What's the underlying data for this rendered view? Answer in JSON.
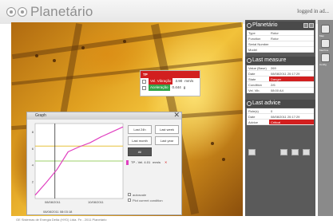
{
  "app": {
    "title": "Planetário",
    "logged_in": "logged in ad..."
  },
  "sensor_popup": {
    "header": "TP",
    "rows": [
      {
        "label": "Vel. Vibração",
        "value": "3.90",
        "unit": "mm/s",
        "color": "#d21f1f"
      },
      {
        "label": "Aceleração",
        "value": "0.444",
        "unit": "g",
        "color": "#33a54a"
      }
    ]
  },
  "graph": {
    "title": "Graph",
    "close": "✕",
    "buttons": [
      "Last 24h",
      "Last week",
      "Last month",
      "Last year",
      "All"
    ],
    "legend": {
      "label": "TP - Vel. 4.01",
      "unit": "mm/s",
      "remove": "✕",
      "color": "#e040c0"
    },
    "options": [
      "autoscale",
      "Plot current condition"
    ],
    "x_ticks": [
      "08/08/2011",
      "10/08/2011"
    ],
    "date_readout": "08/08/2011 08:03:18"
  },
  "chart_data": {
    "type": "line",
    "title": "",
    "xlabel": "",
    "ylabel": "",
    "x_ticks": [
      "08/08/2011",
      "10/08/2011"
    ],
    "y_ticks": [
      8,
      6,
      4,
      2
    ],
    "ylim": [
      0,
      9
    ],
    "thresholds": [
      {
        "value": 6.3,
        "color": "#e7c23a"
      },
      {
        "value": 4.5,
        "color": "#9ed06a"
      }
    ],
    "series": [
      {
        "color": "#e040c0",
        "x": [
          0,
          1,
          2,
          3,
          4,
          5,
          6,
          7,
          8
        ],
        "y": [
          0.4,
          1.9,
          3.5,
          5.6,
          6.2,
          6.7,
          7.4,
          8.0,
          8.6
        ]
      }
    ],
    "cursor_x": 1.8,
    "grid": false
  },
  "panel": {
    "header": "Planetário",
    "info": [
      {
        "k": "Type",
        "v": "Rotor"
      },
      {
        "k": "Function",
        "v": "Rotor"
      },
      {
        "k": "Serial Number",
        "v": ""
      },
      {
        "k": "Model",
        "v": ""
      }
    ],
    "last_measure_title": "Last measure",
    "last_measure": [
      {
        "k": "Value (Base)",
        "v": "269"
      },
      {
        "k": "Date",
        "v": "08/08/2011 20:17:29"
      },
      {
        "k": "State",
        "v": "Danger",
        "alert": true
      },
      {
        "k": "Condition",
        "v": "2/6"
      },
      {
        "k": "Vel. Vib.",
        "v": "08:00    A4"
      }
    ],
    "last_advice_title": "Last advice",
    "last_advice": [
      {
        "k": "Rule(s)",
        "v": "0"
      },
      {
        "k": "Date",
        "v": "08/08/2011 20:17:29"
      },
      {
        "k": "Advice",
        "v": "Critical",
        "alert": true
      }
    ]
  },
  "strip": {
    "labels": [
      "Map",
      "Machine",
      "Config"
    ]
  },
  "footer": "GE Sistemas de Energia Delta (HYD) Ltda. Fn - 2011 Planetário"
}
